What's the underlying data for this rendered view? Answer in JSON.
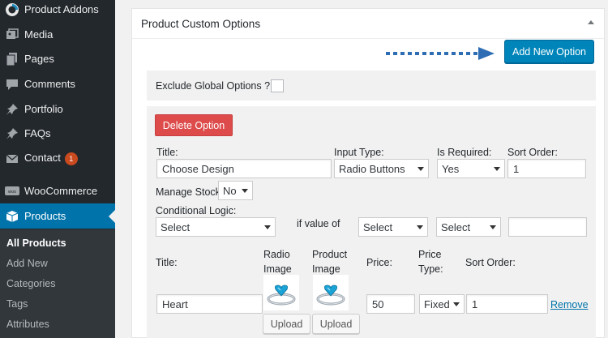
{
  "sidebar": {
    "items": [
      {
        "label": "Product Addons",
        "icon": "product-addons-icon"
      },
      {
        "label": "Media",
        "icon": "media-icon"
      },
      {
        "label": "Pages",
        "icon": "pages-icon"
      },
      {
        "label": "Comments",
        "icon": "comments-icon"
      },
      {
        "label": "Portfolio",
        "icon": "portfolio-icon"
      },
      {
        "label": "FAQs",
        "icon": "faqs-icon"
      },
      {
        "label": "Contact",
        "icon": "contact-icon",
        "badge": "1"
      },
      {
        "label": "WooCommerce",
        "icon": "woocommerce-icon"
      },
      {
        "label": "Products",
        "icon": "products-icon",
        "active": true
      }
    ],
    "submenu": [
      "All Products",
      "Add New",
      "Categories",
      "Tags",
      "Attributes"
    ]
  },
  "panel": {
    "title": "Product Custom Options",
    "add_button": "Add New Option",
    "exclude_label": "Exclude Global Options ?",
    "delete_button": "Delete Option",
    "labels": {
      "title": "Title:",
      "input_type": "Input Type:",
      "is_required": "Is Required:",
      "sort_order": "Sort Order:",
      "manage_stock": "Manage Stock",
      "conditional_logic": "Conditional Logic:",
      "if_value_of": "if value of"
    },
    "values": {
      "title": "Choose Design",
      "input_type": "Radio Buttons",
      "is_required": "Yes",
      "sort_order": "1",
      "manage_stock": "No",
      "cond_select_1": "Select",
      "cond_select_2": "Select",
      "cond_select_3": "Select",
      "cond_text": ""
    },
    "row_headers": {
      "title": "Title:",
      "radio_image_1": "Radio",
      "radio_image_2": "Image",
      "product_image_1": "Product",
      "product_image_2": "Image",
      "price": "Price:",
      "price_type_1": "Price",
      "price_type_2": "Type:",
      "sort_order": "Sort Order:"
    },
    "row": {
      "title": "Heart",
      "price": "50",
      "price_type": "Fixed",
      "sort_order": "1",
      "upload_1": "Upload",
      "upload_2": "Upload",
      "remove": "Remove"
    }
  },
  "colors": {
    "sidebar_bg": "#23282d",
    "active_blue": "#0073aa",
    "primary_button": "#0085ba",
    "danger_button": "#dd4b4b",
    "arrow_dots": "#2e6db3"
  }
}
